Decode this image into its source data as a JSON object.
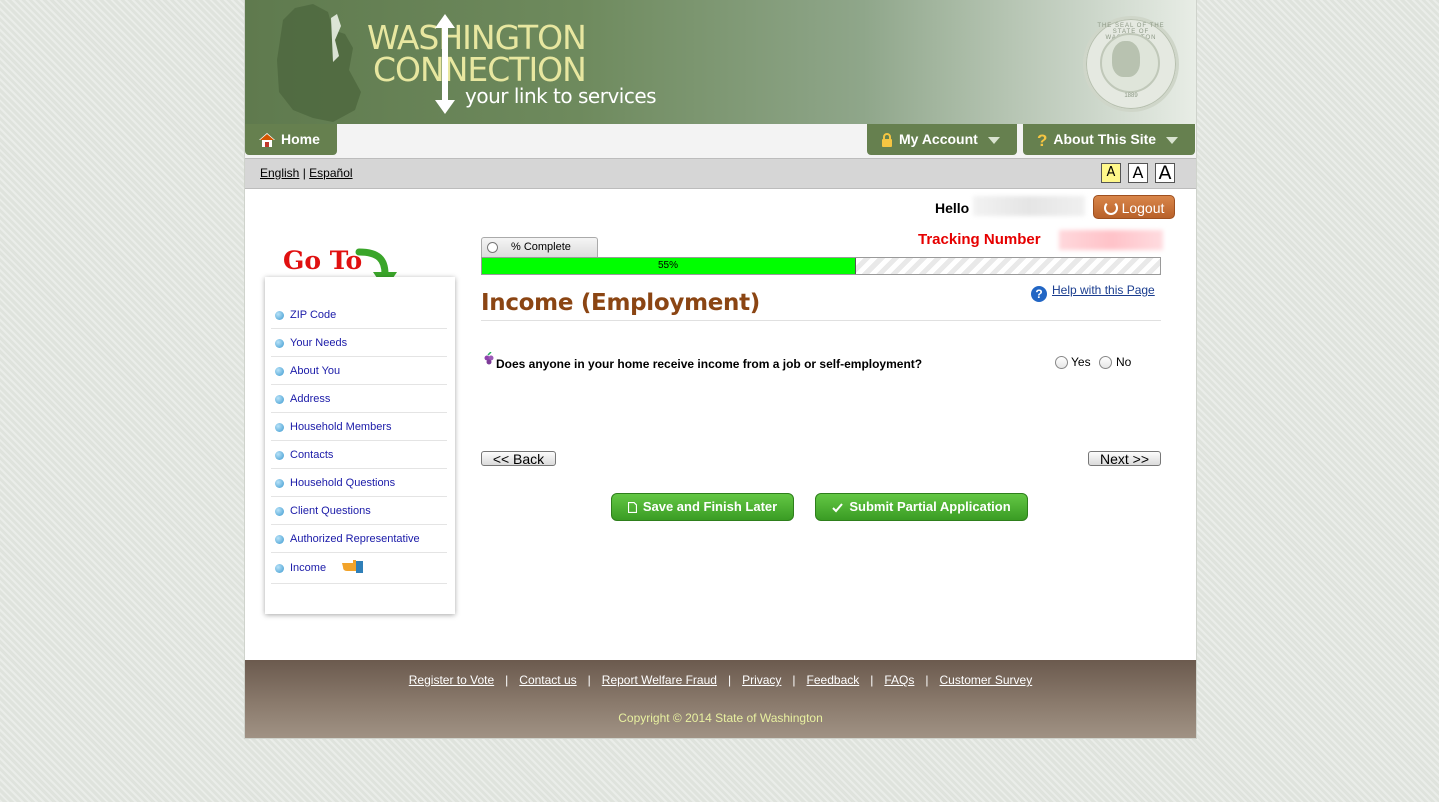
{
  "header": {
    "logo_line1": "WASHINGTON",
    "logo_line2": "CONNECTION",
    "tagline": "your link to services",
    "seal_ring": "THE SEAL OF THE STATE OF WASHINGTON",
    "seal_year": "1889"
  },
  "nav": {
    "home": "Home",
    "my_account": "My Account",
    "about": "About This Site"
  },
  "lang": {
    "english": "English",
    "separator": "|",
    "espanol": "Español"
  },
  "font_sizes": [
    "A",
    "A",
    "A"
  ],
  "user": {
    "hello": "Hello",
    "logout": "Logout"
  },
  "sidebar": {
    "goto": "Go To",
    "items": [
      {
        "label": "ZIP Code"
      },
      {
        "label": "Your Needs"
      },
      {
        "label": "About You"
      },
      {
        "label": "Address"
      },
      {
        "label": "Household Members"
      },
      {
        "label": "Contacts"
      },
      {
        "label": "Household Questions"
      },
      {
        "label": "Client Questions"
      },
      {
        "label": "Authorized Representative"
      },
      {
        "label": "Income"
      }
    ],
    "current": "Income"
  },
  "progress": {
    "tab_label": "% Complete",
    "value": 55,
    "text": "55%"
  },
  "tracking": {
    "label": "Tracking Number"
  },
  "help": "Help with this Page",
  "page_title": "Income (Employment)",
  "question": {
    "text": "Does anyone in your home receive income from a job or self-employment?",
    "options": [
      "Yes",
      "No"
    ],
    "selected": null
  },
  "buttons": {
    "back": "<< Back",
    "next": "Next >>",
    "save": "Save and Finish Later",
    "submit": "Submit Partial Application"
  },
  "footer": {
    "links": [
      "Register to Vote",
      "Contact us",
      "Report Welfare Fraud",
      "Privacy",
      "Feedback",
      "FAQs",
      "Customer Survey"
    ],
    "copyright": "Copyright © 2014 State of Washington"
  },
  "colors": {
    "header_green": "#66804f",
    "progress_fill": "#00ff00",
    "title_brown": "#8b4513",
    "tracking_red": "#e60000",
    "button_green": "#3a9c24",
    "logout_orange": "#c26d33"
  }
}
